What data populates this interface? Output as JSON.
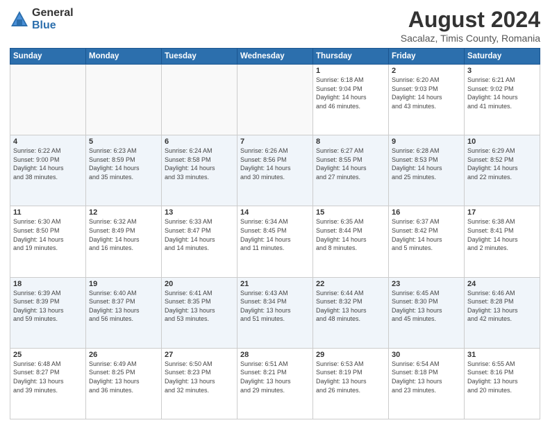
{
  "header": {
    "logo_general": "General",
    "logo_blue": "Blue",
    "main_title": "August 2024",
    "sub_title": "Sacalaz, Timis County, Romania"
  },
  "calendar": {
    "headers": [
      "Sunday",
      "Monday",
      "Tuesday",
      "Wednesday",
      "Thursday",
      "Friday",
      "Saturday"
    ],
    "rows": [
      [
        {
          "day": "",
          "info": ""
        },
        {
          "day": "",
          "info": ""
        },
        {
          "day": "",
          "info": ""
        },
        {
          "day": "",
          "info": ""
        },
        {
          "day": "1",
          "info": "Sunrise: 6:18 AM\nSunset: 9:04 PM\nDaylight: 14 hours\nand 46 minutes."
        },
        {
          "day": "2",
          "info": "Sunrise: 6:20 AM\nSunset: 9:03 PM\nDaylight: 14 hours\nand 43 minutes."
        },
        {
          "day": "3",
          "info": "Sunrise: 6:21 AM\nSunset: 9:02 PM\nDaylight: 14 hours\nand 41 minutes."
        }
      ],
      [
        {
          "day": "4",
          "info": "Sunrise: 6:22 AM\nSunset: 9:00 PM\nDaylight: 14 hours\nand 38 minutes."
        },
        {
          "day": "5",
          "info": "Sunrise: 6:23 AM\nSunset: 8:59 PM\nDaylight: 14 hours\nand 35 minutes."
        },
        {
          "day": "6",
          "info": "Sunrise: 6:24 AM\nSunset: 8:58 PM\nDaylight: 14 hours\nand 33 minutes."
        },
        {
          "day": "7",
          "info": "Sunrise: 6:26 AM\nSunset: 8:56 PM\nDaylight: 14 hours\nand 30 minutes."
        },
        {
          "day": "8",
          "info": "Sunrise: 6:27 AM\nSunset: 8:55 PM\nDaylight: 14 hours\nand 27 minutes."
        },
        {
          "day": "9",
          "info": "Sunrise: 6:28 AM\nSunset: 8:53 PM\nDaylight: 14 hours\nand 25 minutes."
        },
        {
          "day": "10",
          "info": "Sunrise: 6:29 AM\nSunset: 8:52 PM\nDaylight: 14 hours\nand 22 minutes."
        }
      ],
      [
        {
          "day": "11",
          "info": "Sunrise: 6:30 AM\nSunset: 8:50 PM\nDaylight: 14 hours\nand 19 minutes."
        },
        {
          "day": "12",
          "info": "Sunrise: 6:32 AM\nSunset: 8:49 PM\nDaylight: 14 hours\nand 16 minutes."
        },
        {
          "day": "13",
          "info": "Sunrise: 6:33 AM\nSunset: 8:47 PM\nDaylight: 14 hours\nand 14 minutes."
        },
        {
          "day": "14",
          "info": "Sunrise: 6:34 AM\nSunset: 8:45 PM\nDaylight: 14 hours\nand 11 minutes."
        },
        {
          "day": "15",
          "info": "Sunrise: 6:35 AM\nSunset: 8:44 PM\nDaylight: 14 hours\nand 8 minutes."
        },
        {
          "day": "16",
          "info": "Sunrise: 6:37 AM\nSunset: 8:42 PM\nDaylight: 14 hours\nand 5 minutes."
        },
        {
          "day": "17",
          "info": "Sunrise: 6:38 AM\nSunset: 8:41 PM\nDaylight: 14 hours\nand 2 minutes."
        }
      ],
      [
        {
          "day": "18",
          "info": "Sunrise: 6:39 AM\nSunset: 8:39 PM\nDaylight: 13 hours\nand 59 minutes."
        },
        {
          "day": "19",
          "info": "Sunrise: 6:40 AM\nSunset: 8:37 PM\nDaylight: 13 hours\nand 56 minutes."
        },
        {
          "day": "20",
          "info": "Sunrise: 6:41 AM\nSunset: 8:35 PM\nDaylight: 13 hours\nand 53 minutes."
        },
        {
          "day": "21",
          "info": "Sunrise: 6:43 AM\nSunset: 8:34 PM\nDaylight: 13 hours\nand 51 minutes."
        },
        {
          "day": "22",
          "info": "Sunrise: 6:44 AM\nSunset: 8:32 PM\nDaylight: 13 hours\nand 48 minutes."
        },
        {
          "day": "23",
          "info": "Sunrise: 6:45 AM\nSunset: 8:30 PM\nDaylight: 13 hours\nand 45 minutes."
        },
        {
          "day": "24",
          "info": "Sunrise: 6:46 AM\nSunset: 8:28 PM\nDaylight: 13 hours\nand 42 minutes."
        }
      ],
      [
        {
          "day": "25",
          "info": "Sunrise: 6:48 AM\nSunset: 8:27 PM\nDaylight: 13 hours\nand 39 minutes."
        },
        {
          "day": "26",
          "info": "Sunrise: 6:49 AM\nSunset: 8:25 PM\nDaylight: 13 hours\nand 36 minutes."
        },
        {
          "day": "27",
          "info": "Sunrise: 6:50 AM\nSunset: 8:23 PM\nDaylight: 13 hours\nand 32 minutes."
        },
        {
          "day": "28",
          "info": "Sunrise: 6:51 AM\nSunset: 8:21 PM\nDaylight: 13 hours\nand 29 minutes."
        },
        {
          "day": "29",
          "info": "Sunrise: 6:53 AM\nSunset: 8:19 PM\nDaylight: 13 hours\nand 26 minutes."
        },
        {
          "day": "30",
          "info": "Sunrise: 6:54 AM\nSunset: 8:18 PM\nDaylight: 13 hours\nand 23 minutes."
        },
        {
          "day": "31",
          "info": "Sunrise: 6:55 AM\nSunset: 8:16 PM\nDaylight: 13 hours\nand 20 minutes."
        }
      ]
    ]
  }
}
